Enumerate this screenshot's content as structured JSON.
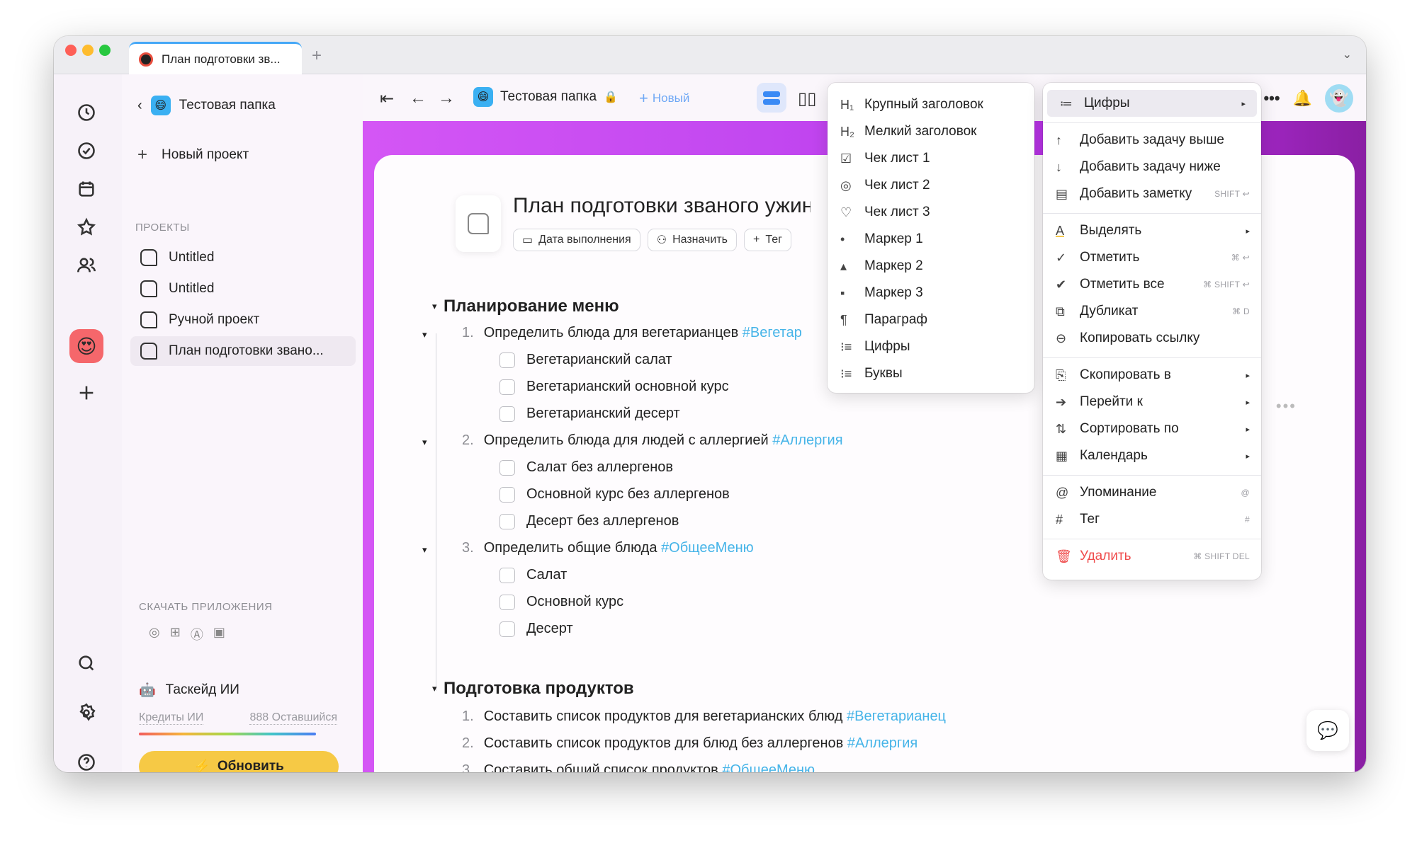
{
  "window": {
    "tab_title": "План подготовки зв...",
    "tab_plus": "+",
    "tab_chevron": "⌄"
  },
  "sidebar": {
    "back_label": "Тестовая папка",
    "new_project": "Новый проект",
    "section_projects": "ПРОЕКТЫ",
    "projects": [
      {
        "label": "Untitled"
      },
      {
        "label": "Untitled"
      },
      {
        "label": "Ручной проект"
      },
      {
        "label": "План подготовки звано..."
      }
    ],
    "download_label": "СКАЧАТЬ ПРИЛОЖЕНИЯ",
    "ai_label": "Таскейд ИИ",
    "credits_label": "Кредиты ИИ",
    "credits_left": "888 Оставшийся",
    "upgrade_label": "Обновить"
  },
  "toolbar": {
    "folder_label": "Тестовая папка",
    "new_label": "Новый"
  },
  "document": {
    "title": "План подготовки званого ужина",
    "chips": {
      "due": "Дата выполнения",
      "assign": "Назначить",
      "tag": "Тег"
    },
    "sections": [
      {
        "heading": "Планирование меню",
        "items": [
          {
            "n": "1.",
            "text": "Определить блюда для вегетарианцев",
            "tag": "#Вегетар",
            "checks": [
              "Вегетарианский салат",
              "Вегетарианский основной курс",
              "Вегетарианский десерт"
            ]
          },
          {
            "n": "2.",
            "text": "Определить блюда для людей с аллергией",
            "tag": "#Аллергия",
            "checks": [
              "Салат без аллергенов",
              "Основной курс без аллергенов",
              "Десерт без аллергенов"
            ]
          },
          {
            "n": "3.",
            "text": "Определить общие блюда",
            "tag": "#ОбщееМеню",
            "checks": [
              "Салат",
              "Основной курс",
              "Десерт"
            ]
          }
        ]
      },
      {
        "heading": "Подготовка продуктов",
        "items": [
          {
            "n": "1.",
            "text": "Составить список продуктов для вегетарианских блюд",
            "tag": "#Вегетарианец"
          },
          {
            "n": "2.",
            "text": "Составить список продуктов для блюд без аллергенов",
            "tag": "#Аллергия"
          },
          {
            "n": "3.",
            "text": "Составить общий список продуктов",
            "tag": "#ОбщееМеню"
          }
        ]
      }
    ]
  },
  "format_menu": [
    {
      "icon": "H₁",
      "label": "Крупный заголовок"
    },
    {
      "icon": "H₂",
      "label": "Мелкий заголовок"
    },
    {
      "icon": "☑",
      "label": "Чек лист 1"
    },
    {
      "icon": "◎",
      "label": "Чек лист 2"
    },
    {
      "icon": "♡",
      "label": "Чек лист 3"
    },
    {
      "icon": "•",
      "label": "Маркер 1"
    },
    {
      "icon": "▴",
      "label": "Маркер 2"
    },
    {
      "icon": "▪",
      "label": "Маркер 3"
    },
    {
      "icon": "¶",
      "label": "Параграф"
    },
    {
      "icon": "⁝≡",
      "label": "Цифры"
    },
    {
      "icon": "⁝≡",
      "label": "Буквы"
    }
  ],
  "context_menu": {
    "header": {
      "icon": "≔",
      "label": "Цифры"
    },
    "group1": [
      {
        "icon": "↑",
        "label": "Добавить задачу выше",
        "short": ""
      },
      {
        "icon": "↓",
        "label": "Добавить задачу ниже",
        "short": ""
      },
      {
        "icon": "▤",
        "label": "Добавить заметку",
        "short": "SHIFT ↩"
      }
    ],
    "group2": [
      {
        "icon": "A",
        "label": "Выделять",
        "short": "▸"
      },
      {
        "icon": "✓",
        "label": "Отметить",
        "short": "⌘ ↩"
      },
      {
        "icon": "✔",
        "label": "Отметить все",
        "short": "⌘ SHIFT ↩"
      },
      {
        "icon": "⧉",
        "label": "Дубликат",
        "short": "⌘ D"
      },
      {
        "icon": "⊖",
        "label": "Копировать ссылку",
        "short": ""
      }
    ],
    "group3": [
      {
        "icon": "⎘",
        "label": "Скопировать в",
        "short": "▸"
      },
      {
        "icon": "➔",
        "label": "Перейти к",
        "short": "▸"
      },
      {
        "icon": "⇅",
        "label": "Сортировать по",
        "short": "▸"
      },
      {
        "icon": "▦",
        "label": "Календарь",
        "short": "▸"
      }
    ],
    "group4": [
      {
        "icon": "@",
        "label": "Упоминание",
        "short": "@"
      },
      {
        "icon": "#",
        "label": "Тег",
        "short": "#"
      }
    ],
    "delete": {
      "icon": "🗑",
      "label": "Удалить",
      "short": "⌘ SHIFT DEL"
    }
  }
}
